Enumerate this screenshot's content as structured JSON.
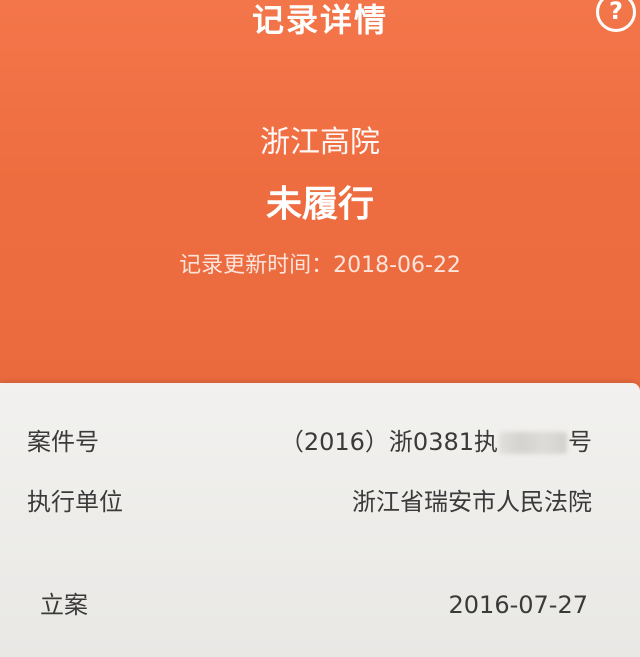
{
  "header": {
    "title": "记录详情",
    "help_icon": "question-circle-icon",
    "court_name": "浙江高院",
    "status": "未履行",
    "update_time_label": "记录更新时间：",
    "update_time_value": "2018-06-22"
  },
  "details": {
    "case_number": {
      "label": "案件号",
      "value_prefix": "（2016）浙0381执",
      "value_suffix": "号"
    },
    "executing_unit": {
      "label": "执行单位",
      "value": "浙江省瑞安市人民法院"
    },
    "filed": {
      "label": "立案",
      "value": "2016-07-27"
    }
  },
  "colors": {
    "header_bg": "#ee6d40",
    "card_bg": "#f0efed",
    "text_dark": "#3a3a3a"
  }
}
